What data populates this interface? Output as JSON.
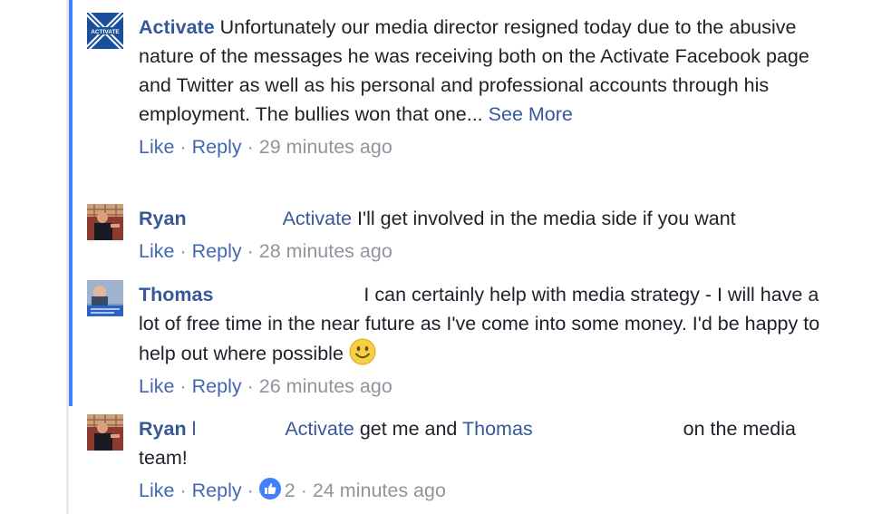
{
  "comments": [
    {
      "author": "Activate",
      "text": "Unfortunately our media director resigned today due to the abusive nature of the messages he was receiving both on the Activate Facebook page and Twitter as well as his personal and professional accounts through his employment. The bullies won that one...",
      "see_more": "See More",
      "actions": {
        "like": "Like",
        "reply": "Reply",
        "time": "29 minutes ago"
      }
    },
    {
      "author": "Ryan",
      "mention": "Activate",
      "text": "I'll get involved in the media side if you want",
      "actions": {
        "like": "Like",
        "reply": "Reply",
        "time": "28 minutes ago"
      }
    },
    {
      "author": "Thomas",
      "text": "I can certainly help with media strategy - I will have a lot of free time in the near future as I've come into some money. I'd be happy to help out where possible",
      "emoji": "smiling-face",
      "actions": {
        "like": "Like",
        "reply": "Reply",
        "time": "26 minutes ago"
      }
    },
    {
      "author": "Ryan",
      "author_suffix": "l",
      "mention": "Activate",
      "text_a": "get me and",
      "mention2": "Thomas",
      "text_b": "on the media team!",
      "actions": {
        "like": "Like",
        "reply": "Reply",
        "reactions": "2",
        "time": "24 minutes ago"
      }
    }
  ],
  "avatar_labels": {
    "activate": "ACTIVATE"
  },
  "colors": {
    "link": "#365899",
    "accent": "#4080ff",
    "meta": "#90949c",
    "text": "#1d2129"
  }
}
